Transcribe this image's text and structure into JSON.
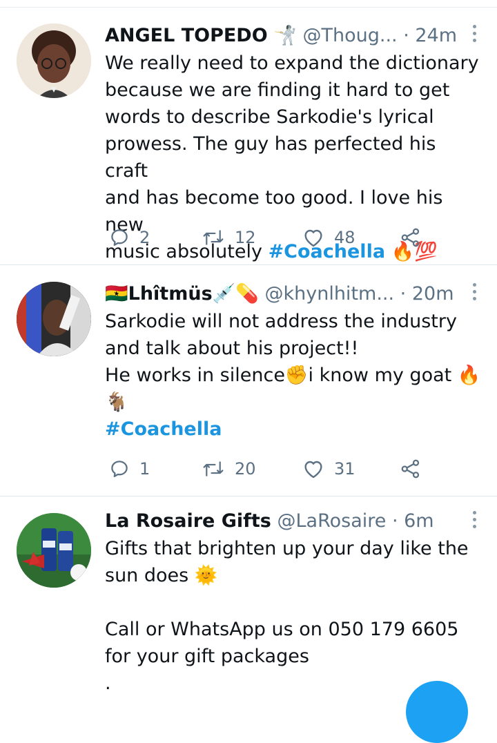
{
  "tweets": [
    {
      "name": "ANGEL TOPEDO",
      "name_emoji": "🤺",
      "handle": "@Thoug...",
      "time": "· 24m",
      "lines": [
        "We really need to expand the dictionary",
        "because we are finding it hard to get",
        "words to describe Sarkodie's lyrical",
        "prowess. The guy has perfected his craft",
        "and has become too good. I love his new"
      ],
      "last_line_text": "music absolutely ",
      "hashtag": "#Coachella",
      "trailing_emoji": "🔥💯",
      "replies": "2",
      "retweets": "12",
      "likes": "48"
    },
    {
      "name_prefix_emoji": "🇬🇭",
      "name": "Lhîtmüs",
      "name_emoji": "💉💊",
      "handle": "@khynlhitm...",
      "time": "· 20m",
      "lines": [
        "Sarkodie will not address the industry",
        "and talk about his project!!",
        "He works in silence✊i know my goat 🔥",
        "🐐"
      ],
      "hashtag": "#Coachella",
      "replies": "1",
      "retweets": "20",
      "likes": "31"
    },
    {
      "name": "La Rosaire Gifts",
      "handle": "@LaRosaire",
      "time": "· 6m",
      "lines": [
        "Gifts that brighten up your day like the",
        "sun does 🌞",
        "",
        "Call or WhatsApp us on 050 179 6605",
        "for your gift packages",
        "."
      ]
    }
  ],
  "colors": {
    "accent": "#1da1f2",
    "hashtag": "#1b95e0",
    "secondary": "#5b7083"
  }
}
